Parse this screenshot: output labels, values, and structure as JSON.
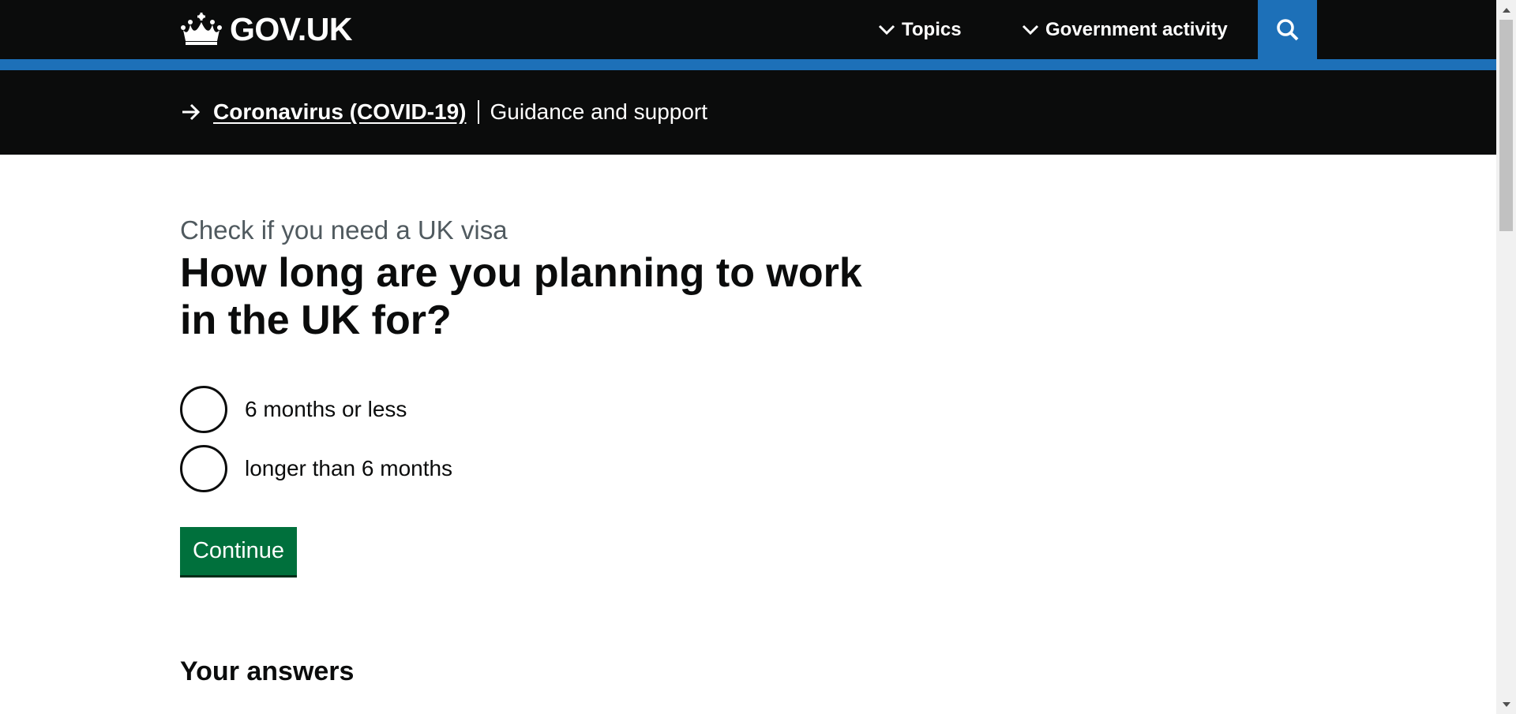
{
  "header": {
    "logo_text": "GOV.UK",
    "nav": {
      "topics_label": "Topics",
      "gov_activity_label": "Government activity"
    },
    "search_icon": "search-icon",
    "colors": {
      "header_bg": "#0b0c0c",
      "accent_blue": "#1d70b8"
    }
  },
  "banner": {
    "link_label": "Coronavirus (COVID-19)",
    "text": "Guidance and support"
  },
  "main": {
    "caption": "Check if you need a UK visa",
    "question": "How long are you planning to work in the UK for?",
    "options": [
      {
        "label": "6 months or less",
        "selected": false
      },
      {
        "label": "longer than 6 months",
        "selected": false
      }
    ],
    "continue_label": "Continue",
    "answers_heading": "Your answers",
    "colors": {
      "button_green": "#00703c",
      "caption_grey": "#505a5f"
    }
  }
}
